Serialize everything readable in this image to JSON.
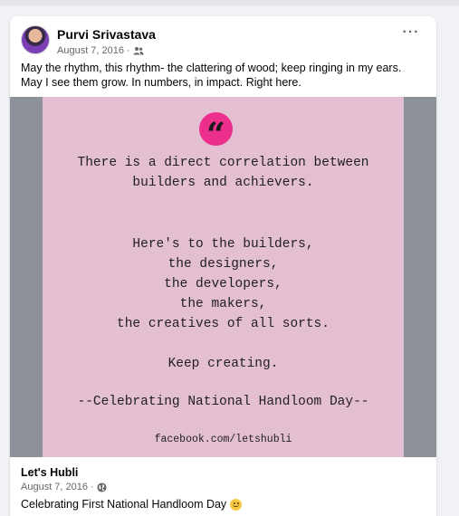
{
  "post": {
    "author": "Purvi Srivastava",
    "date": "August 7, 2016",
    "separator": "·",
    "audience_icon": "friends-icon",
    "more_label": "···",
    "text_lines": [
      "May the rhythm, this rhythm- the clattering of wood; keep ringing in my ears.",
      "May I see them grow. In numbers, in impact.  Right here."
    ]
  },
  "image": {
    "quote_mark": "“",
    "block1": [
      "There is a direct correlation between",
      "builders and achievers."
    ],
    "block2": [
      "Here's to the builders,",
      "the designers,",
      "the developers,",
      "the makers,",
      "the creatives of all sorts."
    ],
    "block3": "Keep creating.",
    "block4": "--Celebrating National Handloom Day--",
    "link": "facebook.com/letshubli",
    "colors": {
      "pink": "#e4bfd2",
      "badge": "#ec2f8d",
      "side": "#8d9199"
    }
  },
  "shared": {
    "page_name": "Let's Hubli",
    "date": "August 7, 2016",
    "separator": "·",
    "audience_icon": "globe-icon",
    "text": "Celebrating First National Handloom Day",
    "emoji_icon": "smile-icon"
  }
}
